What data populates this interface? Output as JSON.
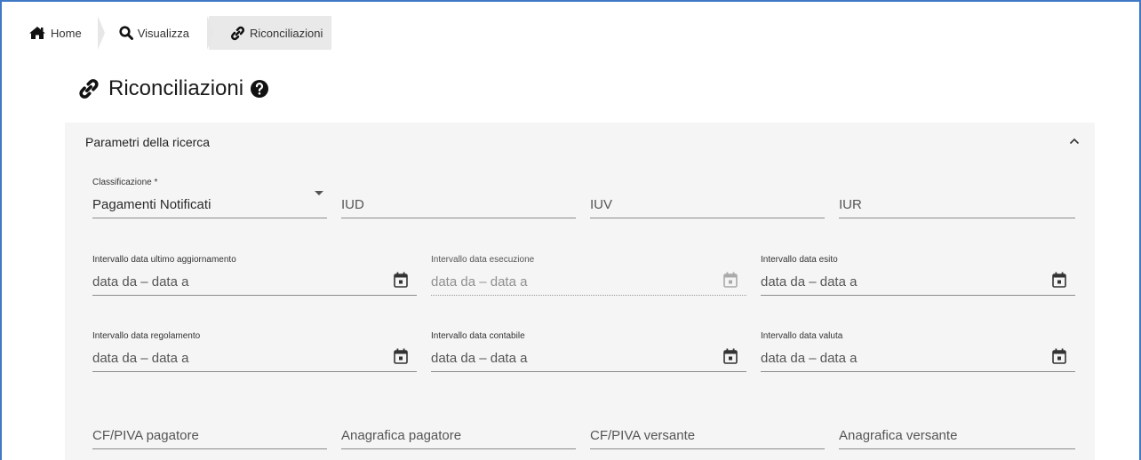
{
  "breadcrumb": {
    "home": "Home",
    "visualizza": "Visualizza",
    "riconciliazioni": "Riconciliazioni"
  },
  "page": {
    "title": "Riconciliazioni"
  },
  "panel": {
    "header": "Parametri della ricerca",
    "expanded": true
  },
  "filters": {
    "classificazione": {
      "label": "Classificazione *",
      "value": "Pagamenti Notificati"
    },
    "iud": {
      "placeholder": "IUD"
    },
    "iuv": {
      "placeholder": "IUV"
    },
    "iur": {
      "placeholder": "IUR"
    },
    "data_ultimo_aggiornamento": {
      "label": "Intervallo data ultimo aggiornamento",
      "placeholder": "data da – data a"
    },
    "data_esecuzione": {
      "label": "Intervallo data esecuzione",
      "placeholder": "data da – data a",
      "disabled": true
    },
    "data_esito": {
      "label": "Intervallo data esito",
      "placeholder": "data da – data a"
    },
    "data_regolamento": {
      "label": "Intervallo data regolamento",
      "placeholder": "data da – data a"
    },
    "data_contabile": {
      "label": "Intervallo data contabile",
      "placeholder": "data da – data a"
    },
    "data_valuta": {
      "label": "Intervallo data valuta",
      "placeholder": "data da – data a"
    },
    "cf_piva_pagatore": {
      "placeholder": "CF/PIVA pagatore"
    },
    "anagrafica_pagatore": {
      "placeholder": "Anagrafica pagatore"
    },
    "cf_piva_versante": {
      "placeholder": "CF/PIVA versante"
    },
    "anagrafica_versante": {
      "placeholder": "Anagrafica versante"
    }
  },
  "icons": {
    "home": "home-icon",
    "search": "search-icon",
    "link": "link-icon",
    "help": "help-circle-icon",
    "calendar": "calendar-icon",
    "chevron_up": "chevron-up-icon"
  },
  "colors": {
    "frame": "#3f78c4",
    "panel_bg": "#f5f5f5",
    "active_crumb": "#e9e9e9"
  }
}
